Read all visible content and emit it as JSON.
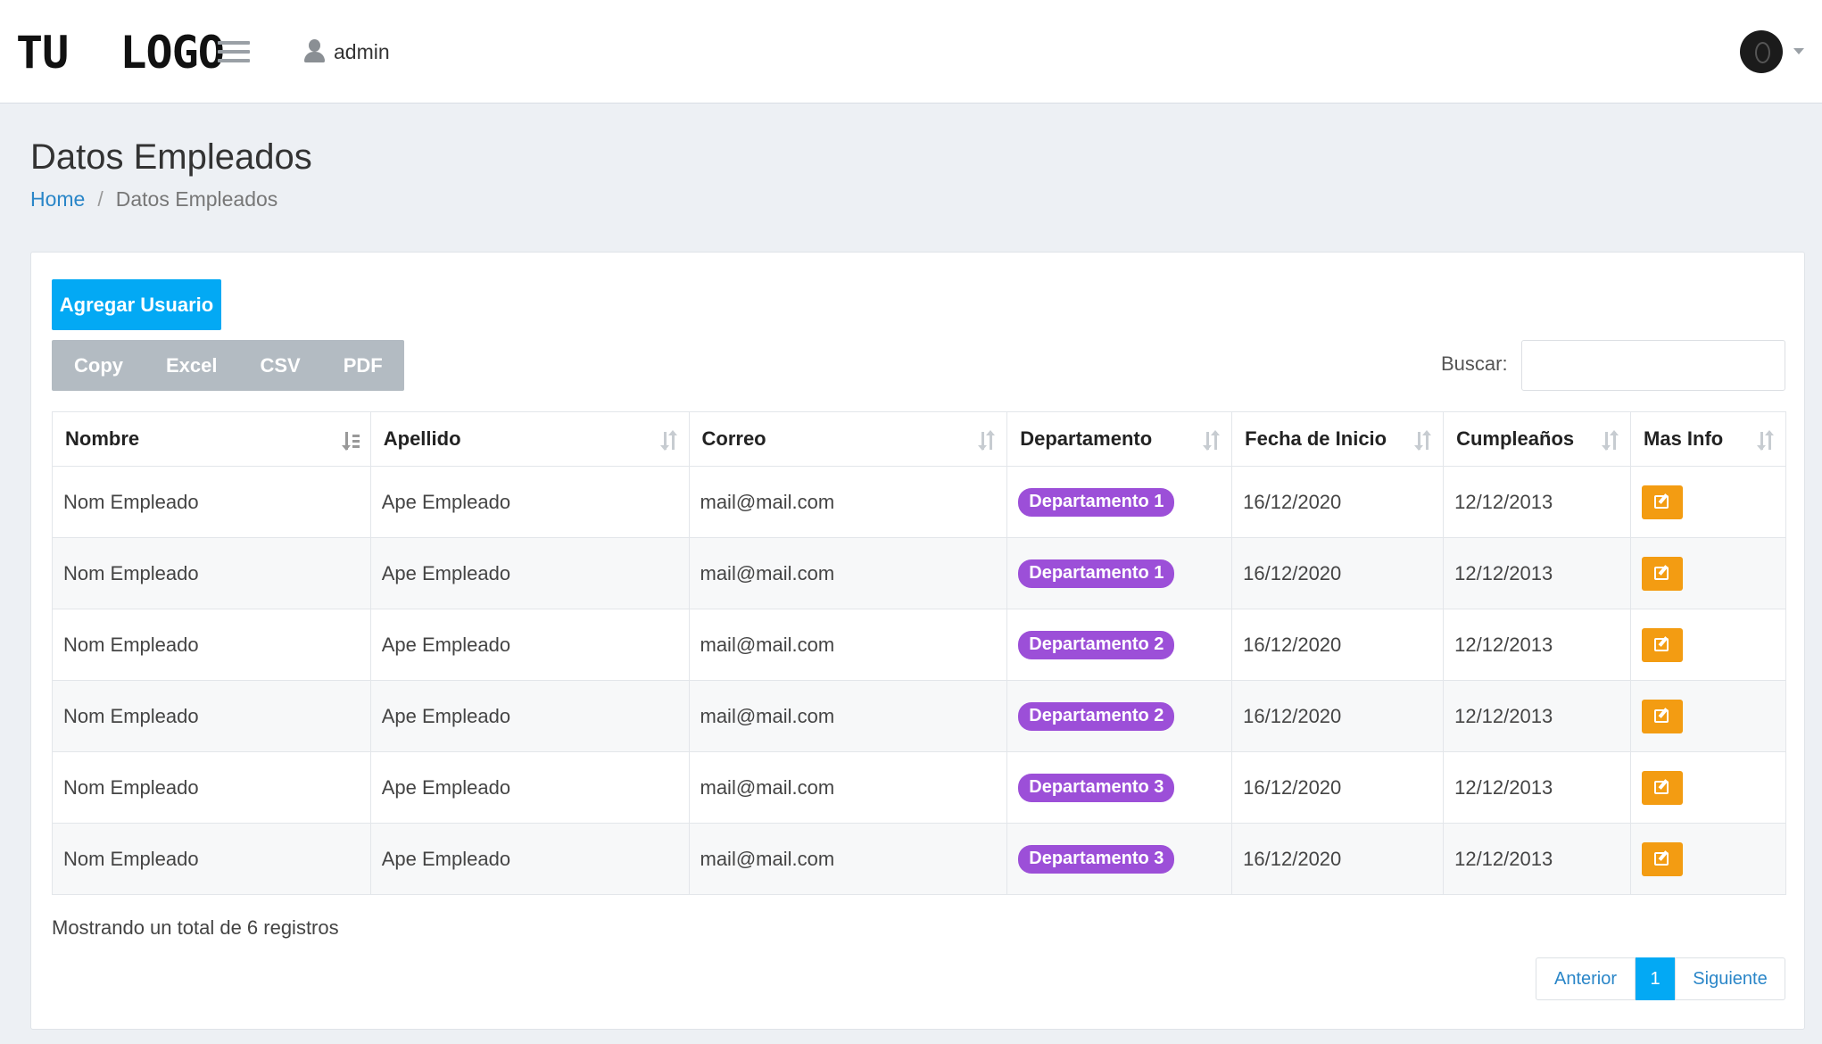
{
  "header": {
    "logo": "TU  LOGO",
    "user": "admin"
  },
  "page": {
    "title": "Datos Empleados",
    "breadcrumb": {
      "home": "Home",
      "separator": "/",
      "current": "Datos Empleados"
    }
  },
  "toolbar": {
    "add_label": "Agregar Usuario",
    "export": [
      "Copy",
      "Excel",
      "CSV",
      "PDF"
    ],
    "search_label": "Buscar:",
    "search_value": ""
  },
  "table": {
    "columns": [
      "Nombre",
      "Apellido",
      "Correo",
      "Departamento",
      "Fecha de Inicio",
      "Cumpleaños",
      "Mas Info"
    ],
    "rows": [
      {
        "nombre": "Nom Empleado",
        "apellido": "Ape Empleado",
        "correo": "mail@mail.com",
        "departamento": "Departamento 1",
        "inicio": "16/12/2020",
        "cumple": "12/12/2013"
      },
      {
        "nombre": "Nom Empleado",
        "apellido": "Ape Empleado",
        "correo": "mail@mail.com",
        "departamento": "Departamento 1",
        "inicio": "16/12/2020",
        "cumple": "12/12/2013"
      },
      {
        "nombre": "Nom Empleado",
        "apellido": "Ape Empleado",
        "correo": "mail@mail.com",
        "departamento": "Departamento 2",
        "inicio": "16/12/2020",
        "cumple": "12/12/2013"
      },
      {
        "nombre": "Nom Empleado",
        "apellido": "Ape Empleado",
        "correo": "mail@mail.com",
        "departamento": "Departamento 2",
        "inicio": "16/12/2020",
        "cumple": "12/12/2013"
      },
      {
        "nombre": "Nom Empleado",
        "apellido": "Ape Empleado",
        "correo": "mail@mail.com",
        "departamento": "Departamento 3",
        "inicio": "16/12/2020",
        "cumple": "12/12/2013"
      },
      {
        "nombre": "Nom Empleado",
        "apellido": "Ape Empleado",
        "correo": "mail@mail.com",
        "departamento": "Departamento 3",
        "inicio": "16/12/2020",
        "cumple": "12/12/2013"
      }
    ]
  },
  "footer": {
    "info": "Mostrando un total de 6 registros",
    "pagination": {
      "prev": "Anterior",
      "current": "1",
      "next": "Siguiente"
    }
  },
  "colors": {
    "primary": "#03a9f4",
    "badge": "#9c4fd8",
    "edit": "#f39c12",
    "link": "#2a86c8"
  }
}
